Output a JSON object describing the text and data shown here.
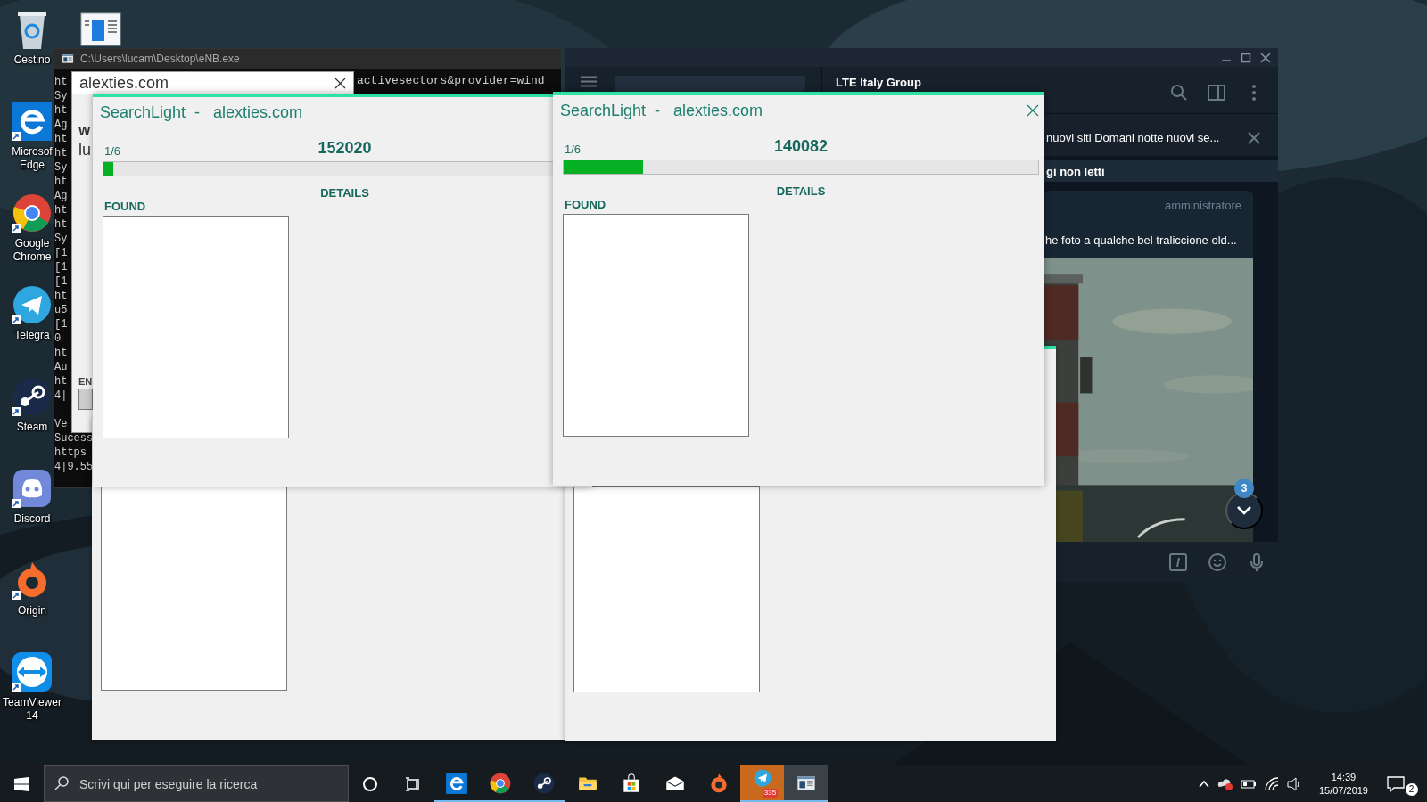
{
  "desktop": {
    "icons": [
      {
        "kind": "recycle-bin",
        "label": [
          "Cestino"
        ],
        "shortcut": false
      },
      {
        "kind": "edge",
        "label": [
          "Microsof",
          "Edge"
        ],
        "shortcut": true
      },
      {
        "kind": "chrome",
        "label": [
          "Google",
          "Chrome"
        ],
        "shortcut": true
      },
      {
        "kind": "telegram",
        "label": [
          "Telegra"
        ],
        "shortcut": true
      },
      {
        "kind": "steam",
        "label": [
          "Steam"
        ],
        "shortcut": true
      },
      {
        "kind": "discord",
        "label": [
          "Discord"
        ],
        "shortcut": true
      },
      {
        "kind": "origin",
        "label": [
          "Origin"
        ],
        "shortcut": true
      },
      {
        "kind": "teamviewer",
        "label": [
          "TeamViewer",
          "14"
        ],
        "shortcut": true
      }
    ],
    "second_column": [
      {
        "kind": "app-window"
      }
    ]
  },
  "console": {
    "title": "C:\\Users\\lucam\\Desktop\\eNB.exe",
    "overflow_line": "activesectors&provider=wind",
    "blocks": [
      [
        "ht",
        "Sy",
        "ht",
        "Ag",
        "ht",
        "ht",
        "Sy",
        "ht",
        "Ag",
        "ht",
        "ht",
        "Sy",
        "[1",
        "[1",
        "[1",
        "ht",
        "u5",
        "[1",
        "0",
        "ht",
        "Au",
        "ht",
        "4|"
      ],
      [
        "Ve",
        "Sucess",
        "https",
        "4|9.55"
      ]
    ]
  },
  "dialog": {
    "title": "alexties.com",
    "label_1": "W",
    "value_1": "lu",
    "label_2": "EN"
  },
  "telegram": {
    "chat_title": "LTE Italy Group",
    "pinned": "nuovi siti Domani notte nuovi se...",
    "unread_divider": "gi non letti",
    "message": {
      "author_role": "amministratore",
      "text": "he foto a qualche bel traliccione old..."
    },
    "unread_badge": "3"
  },
  "searchlight_windows": [
    {
      "title": "SearchLight  -   alexties.com",
      "step": "1/6",
      "count": "152020",
      "level": 0.02,
      "details_label": "DETAILS",
      "found_label": "FOUND",
      "close_visible": false
    },
    {
      "title": "SearchLight  -   alexties.com",
      "step": "1/6",
      "count": "140082",
      "level": 0.167,
      "details_label": "DETAILS",
      "found_label": "FOUND",
      "close_visible": true
    }
  ],
  "taskbar": {
    "search_placeholder": "Scrivi qui per eseguire la ricerca",
    "apps": [
      {
        "kind": "edge",
        "running": true,
        "flashing": false,
        "focused": false
      },
      {
        "kind": "chrome",
        "running": true,
        "flashing": false,
        "focused": false
      },
      {
        "kind": "steam",
        "running": true,
        "flashing": false,
        "focused": false
      },
      {
        "kind": "explorer",
        "running": false,
        "flashing": false,
        "focused": false
      },
      {
        "kind": "store",
        "running": false,
        "flashing": false,
        "focused": false
      },
      {
        "kind": "mail",
        "running": false,
        "flashing": false,
        "focused": false
      },
      {
        "kind": "origin",
        "running": false,
        "flashing": false,
        "focused": false
      },
      {
        "kind": "telegram",
        "running": true,
        "flashing": true,
        "focused": false,
        "badge": "335"
      },
      {
        "kind": "console",
        "running": true,
        "flashing": false,
        "focused": true
      }
    ],
    "time": "14:39",
    "date": "15/07/2019",
    "notifications": "2"
  }
}
